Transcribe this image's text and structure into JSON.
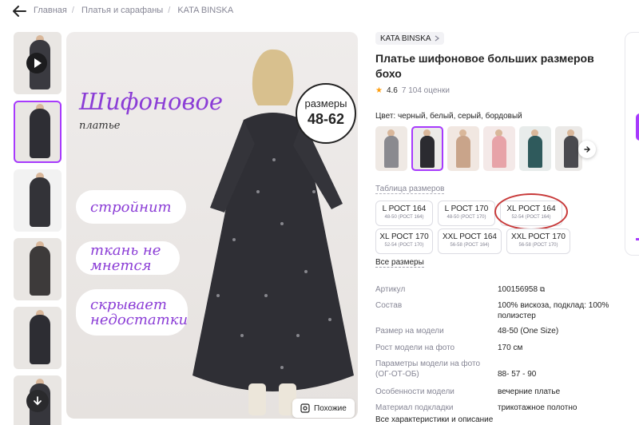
{
  "breadcrumb": {
    "items": [
      "Главная",
      "Платья и сарафаны",
      "KATA BINSKA"
    ]
  },
  "gallery": {
    "thumbs": [
      {
        "name": "video",
        "color": "#3a3a40",
        "has_play": true
      },
      {
        "name": "photo-1",
        "color": "#2e2e34"
      },
      {
        "name": "photo-2",
        "color": "#333338"
      },
      {
        "name": "photo-3",
        "color": "#3d3a3a"
      },
      {
        "name": "photo-4",
        "color": "#2d2d33"
      },
      {
        "name": "photo-5",
        "color": "#36363c"
      }
    ],
    "main": {
      "title": "Шифоновое",
      "subtitle": "платье",
      "badge_line1": "размеры",
      "badge_line2": "48-62",
      "pills": [
        "стройнит",
        "ткань не мнется",
        "скрывает недостатки"
      ],
      "similar_label": "Похожие"
    }
  },
  "product": {
    "brand": "KATA BINSKA",
    "title": "Платье шифоновое больших размеров бохо",
    "rating": "4.6",
    "reviews": "7 104 оценки",
    "colors_label": "Цвет:",
    "colors_value": "черный, белый, серый, бордовый",
    "swatches": [
      {
        "color": "#8a8a8f"
      },
      {
        "color": "#2b2b30"
      },
      {
        "color": "#c9a48a"
      },
      {
        "color": "#e7a3a8"
      },
      {
        "color": "#2f5a5c"
      },
      {
        "color": "#4a4a4f"
      },
      {
        "color": "#e6d59a"
      }
    ],
    "size_table_link": "Таблица размеров",
    "sizes": [
      {
        "main": "L РОСТ 164",
        "sub": "48-50 (РОСТ 164)"
      },
      {
        "main": "L РОСТ 170",
        "sub": "48-50 (РОСТ 170)"
      },
      {
        "main": "XL РОСТ 164",
        "sub": "52-54 (РОСТ 164)"
      },
      {
        "main": "XL РОСТ 170",
        "sub": "52-54 (РОСТ 170)"
      },
      {
        "main": "XXL РОСТ 164",
        "sub": "56-58 (РОСТ 164)"
      },
      {
        "main": "XXL РОСТ 170",
        "sub": "56-58 (РОСТ 170)"
      }
    ],
    "all_sizes": "Все размеры",
    "specs": [
      {
        "k": "Артикул",
        "v": "100156958"
      },
      {
        "k": "Состав",
        "v": "100% вискоза, подклад: 100% полиэстер"
      },
      {
        "k": "Размер на модели",
        "v": "48-50 (One Size)"
      },
      {
        "k": "Рост модели на фото",
        "v": "170 см"
      },
      {
        "k": "Параметры модели на фото (ОГ-ОТ-ОБ)",
        "v": "88- 57 - 90"
      },
      {
        "k": "Особенности модели",
        "v": "вечерние платье"
      },
      {
        "k": "Материал подкладки",
        "v": "трикотажное полотно"
      }
    ],
    "all_specs": "Все характеристики и описание"
  },
  "accent_color": "#a73afd",
  "highlight_color": "#c83a3a"
}
